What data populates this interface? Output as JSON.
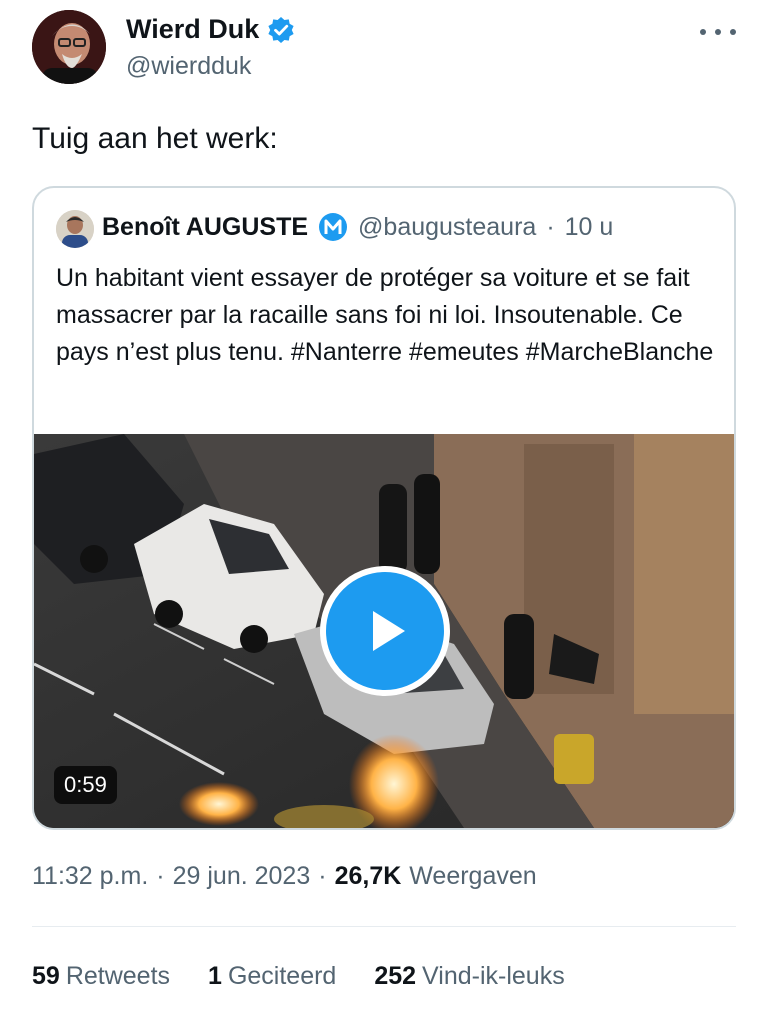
{
  "author": {
    "name": "Wierd Duk",
    "handle": "@wierdduk",
    "icons": {
      "verified": "verified-badge-icon",
      "more": "more-options-icon"
    }
  },
  "tweet": {
    "text": "Tuig aan het werk:"
  },
  "quote": {
    "name": "Benoît AUGUSTE",
    "handle": "@baugusteaura",
    "separator": "·",
    "time": "10 u",
    "text": "Un habitant vient essayer de protéger sa voiture et se fait massacrer par la racaille sans foi ni loi. Insoutenable. Ce pays n’est plus tenu. #Nanterre #emeutes #MarcheBlanche",
    "media": {
      "duration": "0:59",
      "icon": "play-icon"
    }
  },
  "meta": {
    "time": "11:32 p.m.",
    "sep1": "·",
    "date": "29 jun. 2023",
    "sep2": "·",
    "views_count": "26,7K",
    "views_label": "Weergaven"
  },
  "stats": {
    "retweets_count": "59",
    "retweets_label": "Retweets",
    "quotes_count": "1",
    "quotes_label": "Geciteerd",
    "likes_count": "252",
    "likes_label": "Vind-ik-leuks"
  },
  "colors": {
    "accent": "#1d9bf0",
    "text_primary": "#0f1419",
    "text_secondary": "#536471",
    "border": "#cfd9de"
  }
}
